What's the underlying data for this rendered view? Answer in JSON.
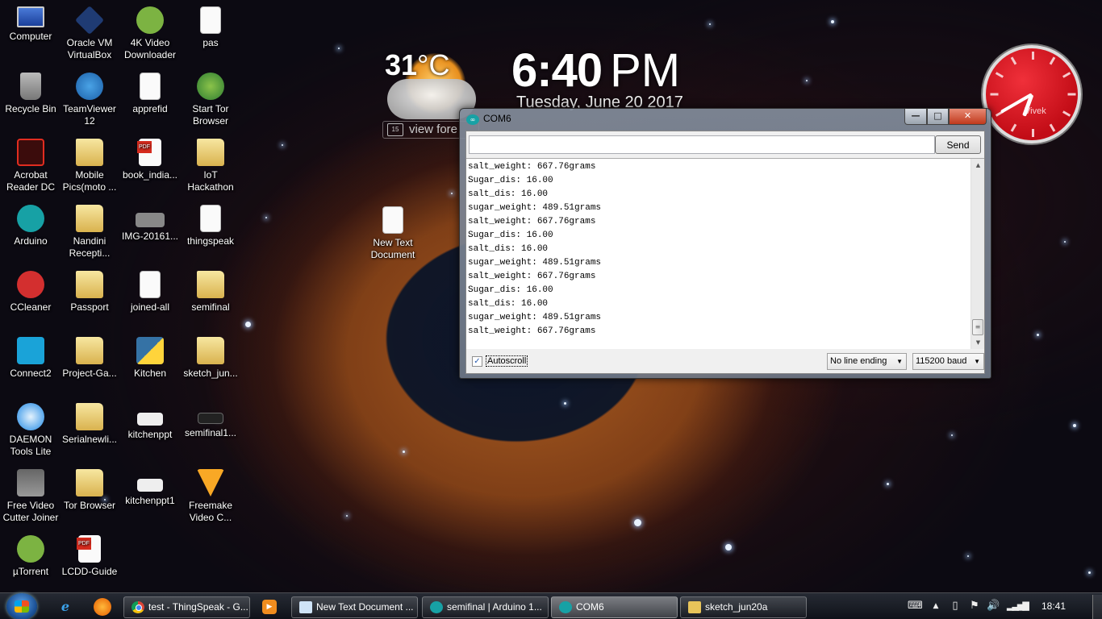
{
  "desktop": {
    "icons": [
      {
        "label": "Computer",
        "type": "computer"
      },
      {
        "label": "Oracle VM VirtualBox",
        "type": "vbox"
      },
      {
        "label": "4K Video Downloader",
        "type": "app-green"
      },
      {
        "label": "pas",
        "type": "doc"
      },
      {
        "label": "Recycle Bin",
        "type": "bin"
      },
      {
        "label": "TeamViewer 12",
        "type": "app-blue"
      },
      {
        "label": "apprefid",
        "type": "doc"
      },
      {
        "label": "Start Tor Browser",
        "type": "tor"
      },
      {
        "label": "Acrobat Reader DC",
        "type": "acrobat"
      },
      {
        "label": "Mobile Pics(moto ...",
        "type": "folder"
      },
      {
        "label": "book_india...",
        "type": "pdf"
      },
      {
        "label": "IoT Hackathon",
        "type": "folder"
      },
      {
        "label": "Arduino",
        "type": "app-teal"
      },
      {
        "label": "Nandini Recepti...",
        "type": "folder"
      },
      {
        "label": "IMG-20161...",
        "type": "img"
      },
      {
        "label": "thingspeak",
        "type": "doc"
      },
      {
        "label": "CCleaner",
        "type": "ccleaner"
      },
      {
        "label": "Passport",
        "type": "folder"
      },
      {
        "label": "joined-all",
        "type": "video"
      },
      {
        "label": "semifinal",
        "type": "folder"
      },
      {
        "label": "Connect2",
        "type": "connect"
      },
      {
        "label": "Project-Ga...",
        "type": "folder"
      },
      {
        "label": "Kitchen",
        "type": "python"
      },
      {
        "label": "sketch_jun...",
        "type": "folder"
      },
      {
        "label": "DAEMON Tools Lite",
        "type": "daemon"
      },
      {
        "label": "Serialnewli...",
        "type": "folder"
      },
      {
        "label": "kitchenppt",
        "type": "ppt"
      },
      {
        "label": "semifinal1...",
        "type": "dark"
      },
      {
        "label": "Free Video Cutter Joiner",
        "type": "fvcj"
      },
      {
        "label": "Tor Browser",
        "type": "folder"
      },
      {
        "label": "kitchenppt1",
        "type": "ppt"
      },
      {
        "label": "Freemake Video C...",
        "type": "freemake"
      },
      {
        "label": "µTorrent",
        "type": "app-green"
      },
      {
        "label": "LCDD-Guide",
        "type": "pdf"
      },
      {
        "label": "New Text Document",
        "type": "doc"
      }
    ]
  },
  "weather_gadget": {
    "temperature": "31",
    "unit": "°C",
    "forecast_label": "view fore",
    "calendar_day": "15"
  },
  "clock_gadget": {
    "time": "6:40",
    "ampm": "PM",
    "date": "Tuesday, June 20 2017"
  },
  "analog_clock": {
    "label": "Vivek",
    "hour": 6,
    "minute": 40
  },
  "serial_monitor": {
    "title": "COM6",
    "input_value": "",
    "send_label": "Send",
    "output_lines": [
      "salt_weight: 667.76grams",
      "Sugar_dis: 16.00",
      "salt_dis: 16.00",
      "sugar_weight: 489.51grams",
      "salt_weight: 667.76grams",
      "Sugar_dis: 16.00",
      "salt_dis: 16.00",
      "sugar_weight: 489.51grams",
      "salt_weight: 667.76grams",
      "Sugar_dis: 16.00",
      "salt_dis: 16.00",
      "sugar_weight: 489.51grams",
      "salt_weight: 667.76grams"
    ],
    "autoscroll_label": "Autoscroll",
    "autoscroll_checked": true,
    "line_ending": "No line ending",
    "baud_rate": "115200 baud",
    "scroll_position": 1.0
  },
  "taskbar": {
    "tasks": [
      {
        "label": "test - ThingSpeak - G...",
        "icon": "chrome"
      },
      {
        "label": "New Text Document ...",
        "icon": "notepad"
      },
      {
        "label": "semifinal | Arduino 1...",
        "icon": "arduino"
      },
      {
        "label": "COM6",
        "icon": "arduino",
        "active": true
      },
      {
        "label": "sketch_jun20a",
        "icon": "folder"
      }
    ],
    "tray_clock": "18:41"
  }
}
